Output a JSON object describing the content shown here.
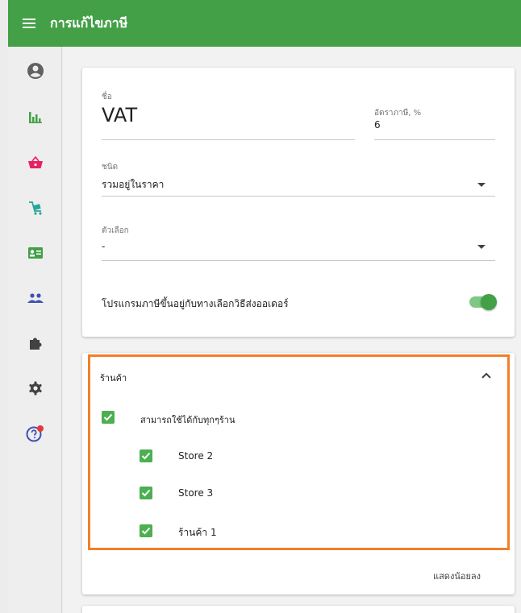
{
  "app": {
    "title": "การแก้ไขภาษี"
  },
  "sidebar": {
    "items": [
      {
        "icon": "account-circle-icon",
        "color": "#616161"
      },
      {
        "icon": "bar-chart-icon",
        "color": "#43a047"
      },
      {
        "icon": "shopping-basket-icon",
        "color": "#e91e63"
      },
      {
        "icon": "cart-icon",
        "color": "#26a69a"
      },
      {
        "icon": "contact-card-icon",
        "color": "#43a047"
      },
      {
        "icon": "people-icon",
        "color": "#3f51b5"
      },
      {
        "icon": "puzzle-icon",
        "color": "#424242"
      },
      {
        "icon": "settings-icon",
        "color": "#424242"
      },
      {
        "icon": "help-icon",
        "color": "#3f51b5",
        "badge_color": "#e53935"
      }
    ]
  },
  "tax": {
    "name_label": "ชื่อ",
    "name_value": "VAT",
    "rate_label": "อัตราภาษี, %",
    "rate_value": "6",
    "type_label": "ชนิด",
    "type_value": "รวมอยู่ในราคา",
    "option_label": "ตัวเลือก",
    "option_value": "-",
    "toggle_label": "โปรแกรมภาษีขึ้นอยู่กับทางเลือกวิธีส่งออเดอร์",
    "toggle_on": true
  },
  "stores": {
    "header": "ร้านค้า",
    "all_label": "สามารถใช้ได้กับทุกๆร้าน",
    "items": [
      {
        "label": "Store 2",
        "checked": true
      },
      {
        "label": "Store 3",
        "checked": true
      },
      {
        "label": "ร้านค้า 1",
        "checked": true
      }
    ],
    "show_less": "แสดงน้อยลง"
  },
  "colors": {
    "accent": "#43a047",
    "highlight": "#f0802a"
  }
}
